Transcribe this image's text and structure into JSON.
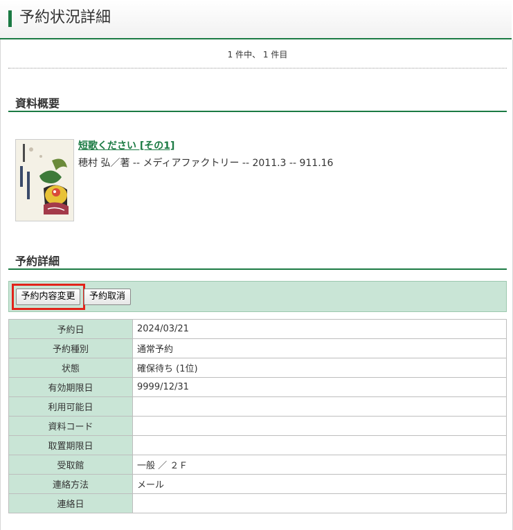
{
  "page": {
    "title": "予約状況詳細"
  },
  "paging": {
    "text": "1 件中、 1 件目"
  },
  "sections": {
    "overview": "資料概要",
    "detail": "予約詳細"
  },
  "book": {
    "title": "短歌ください [その1]",
    "meta": "穂村 弘／著 -- メディアファクトリー -- 2011.3 -- 911.16",
    "cover_icon": "book-cover-illustration"
  },
  "buttons": {
    "change": "予約内容変更",
    "cancel": "予約取消"
  },
  "accent_colors": {
    "green": "#1b7a43",
    "label_bg": "#c9e5d6",
    "highlight": "#e2231a"
  },
  "details": [
    {
      "label": "予約日",
      "value": "2024/03/21"
    },
    {
      "label": "予約種別",
      "value": "通常予約"
    },
    {
      "label": "状態",
      "value": "確保待ち (1位)"
    },
    {
      "label": "有効期限日",
      "value": "9999/12/31"
    },
    {
      "label": "利用可能日",
      "value": ""
    },
    {
      "label": "資料コード",
      "value": ""
    },
    {
      "label": "取置期限日",
      "value": ""
    },
    {
      "label": "受取館",
      "value": "一般 ／ ２Ｆ"
    },
    {
      "label": "連絡方法",
      "value": "メール"
    },
    {
      "label": "連絡日",
      "value": ""
    }
  ]
}
